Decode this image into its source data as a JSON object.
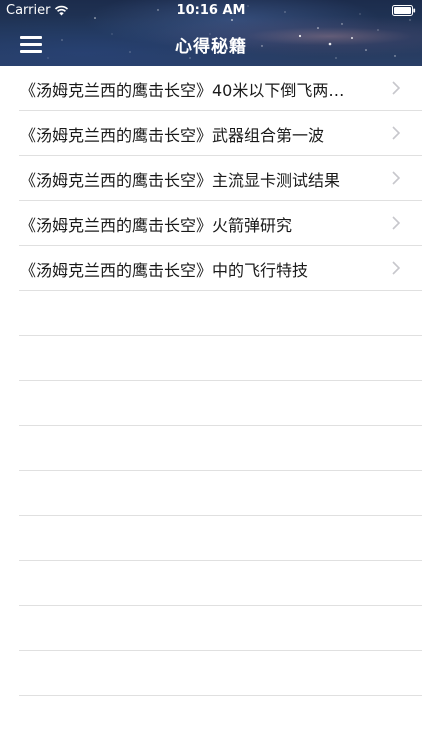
{
  "status_bar": {
    "carrier": "Carrier",
    "time": "10:16 AM"
  },
  "nav": {
    "title": "心得秘籍",
    "menu_icon": "hamburger-menu-icon"
  },
  "list": {
    "items": [
      {
        "label": "《汤姆克兰西的鹰击长空》40米以下倒飞两…"
      },
      {
        "label": "《汤姆克兰西的鹰击长空》武器组合第一波"
      },
      {
        "label": "《汤姆克兰西的鹰击长空》主流显卡测试结果"
      },
      {
        "label": "《汤姆克兰西的鹰击长空》火箭弹研究"
      },
      {
        "label": "《汤姆克兰西的鹰击长空》中的飞行特技"
      }
    ]
  },
  "colors": {
    "header_dark": "#1c2c4c",
    "separator": "#e0e0e0",
    "chevron": "#c7c7cc"
  }
}
